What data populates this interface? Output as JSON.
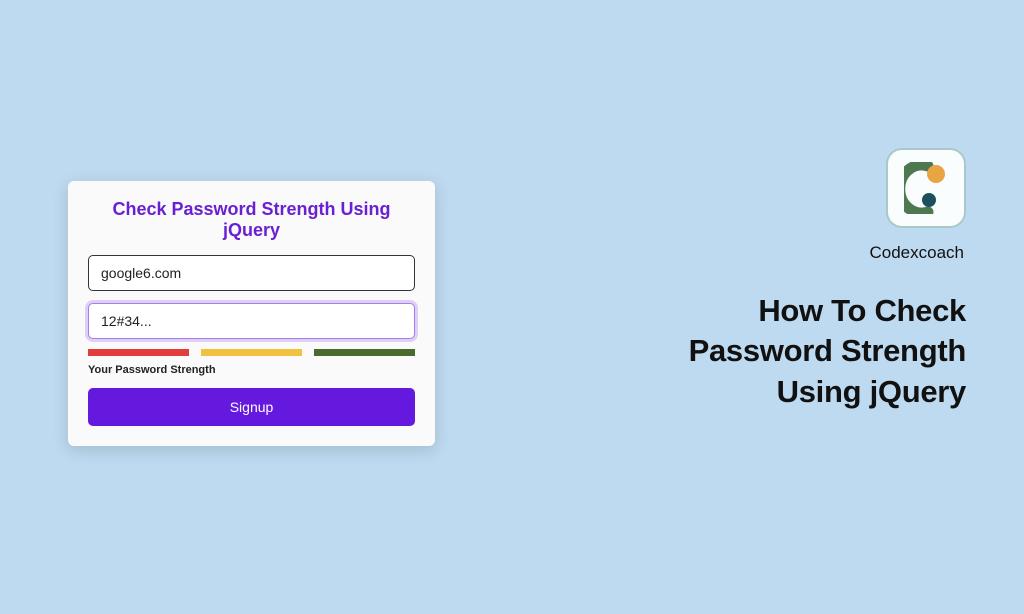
{
  "card": {
    "title": "Check Password Strength Using jQuery",
    "email_value": "google6.com",
    "password_value": "12#34...",
    "strength_label": "Your Password Strength",
    "signup_label": "Signup",
    "strength_colors": {
      "weak": "#e23c3c",
      "medium": "#f0c240",
      "strong": "#4a6b2d"
    }
  },
  "brand": {
    "name": "Codexcoach"
  },
  "headline": "How To Check Password Strength Using jQuery"
}
